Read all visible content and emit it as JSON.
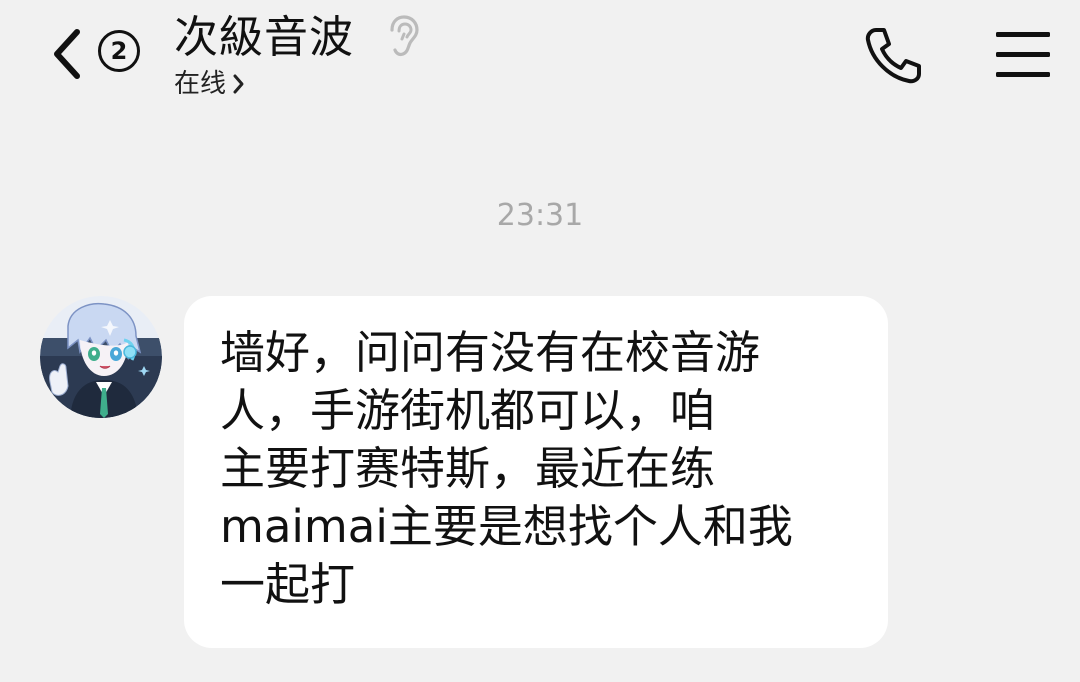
{
  "header": {
    "back_label": "<",
    "unread_count": "2",
    "contact_name": "次級音波",
    "status": "在线",
    "icons": {
      "back": "chevron-left-icon",
      "ear": "ear-icon",
      "status_chevron": "chevron-right-icon",
      "phone": "phone-icon",
      "menu": "menu-icon"
    }
  },
  "chat": {
    "timestamp": "23:31",
    "messages": [
      {
        "sender": "次級音波",
        "lines": [
          "墙好，问问有没有在校音游",
          "人，手游街机都可以，咱",
          "主要打赛特斯，最近在练",
          "maimai主要是想找个人和我",
          "一起打"
        ]
      }
    ]
  },
  "colors": {
    "background": "#f1f1f1",
    "bubble": "#ffffff",
    "timestamp": "#a8a8a8",
    "text": "#111111",
    "ear_icon": "#bbbbbb"
  }
}
